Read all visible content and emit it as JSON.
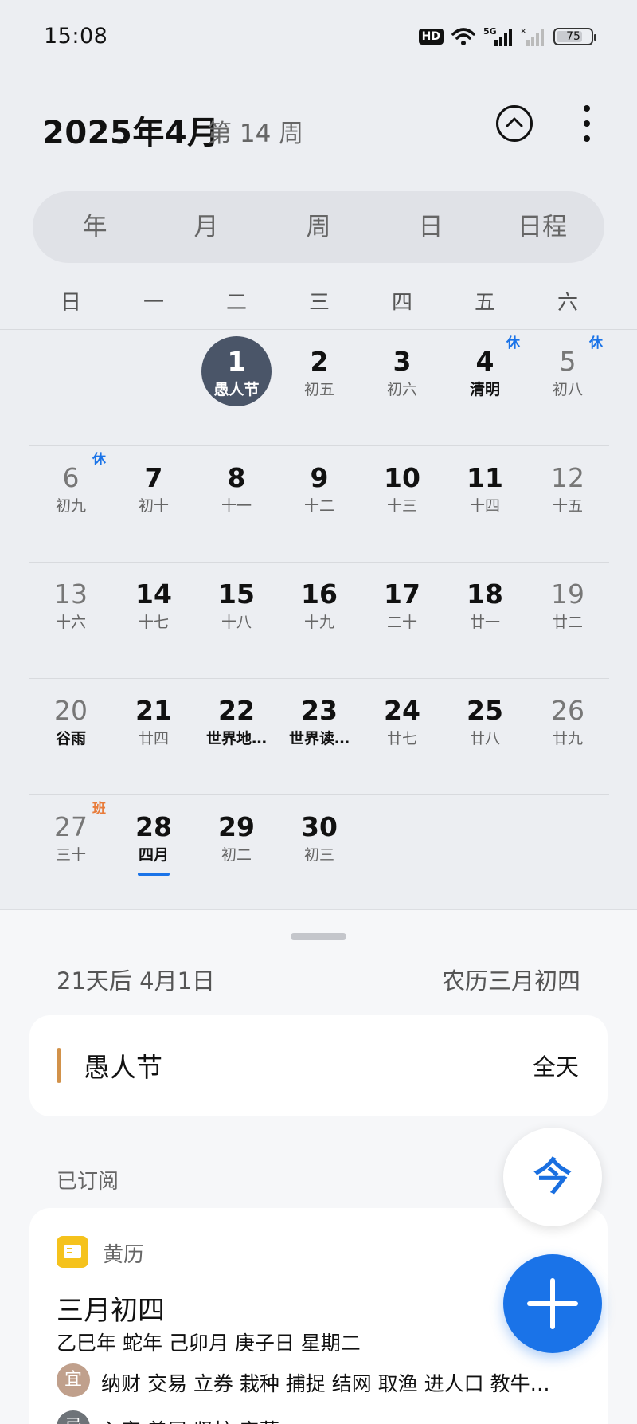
{
  "status_bar": {
    "time": "15:08",
    "hd": "HD",
    "network": "5G",
    "battery_level": 75,
    "battery_text": "75"
  },
  "header": {
    "title": "2025年4月",
    "week": "第 14 周"
  },
  "view_tabs": [
    {
      "label": "年",
      "active": false
    },
    {
      "label": "月",
      "active": true
    },
    {
      "label": "周",
      "active": false
    },
    {
      "label": "日",
      "active": false
    },
    {
      "label": "日程",
      "active": false
    }
  ],
  "weekdays": [
    "日",
    "一",
    "二",
    "三",
    "四",
    "五",
    "六"
  ],
  "weeks": [
    [
      null,
      null,
      {
        "day": "1",
        "lunar": "愚人节",
        "festival": true,
        "selected": true
      },
      {
        "day": "2",
        "lunar": "初五"
      },
      {
        "day": "3",
        "lunar": "初六"
      },
      {
        "day": "4",
        "lunar": "清明",
        "festival": true,
        "tag": "休",
        "tag_type": "rest"
      },
      {
        "day": "5",
        "lunar": "初八",
        "tag": "休",
        "tag_type": "rest"
      }
    ],
    [
      {
        "day": "6",
        "lunar": "初九",
        "tag": "休",
        "tag_type": "rest"
      },
      {
        "day": "7",
        "lunar": "初十"
      },
      {
        "day": "8",
        "lunar": "十一"
      },
      {
        "day": "9",
        "lunar": "十二"
      },
      {
        "day": "10",
        "lunar": "十三"
      },
      {
        "day": "11",
        "lunar": "十四"
      },
      {
        "day": "12",
        "lunar": "十五"
      }
    ],
    [
      {
        "day": "13",
        "lunar": "十六"
      },
      {
        "day": "14",
        "lunar": "十七"
      },
      {
        "day": "15",
        "lunar": "十八"
      },
      {
        "day": "16",
        "lunar": "十九"
      },
      {
        "day": "17",
        "lunar": "二十"
      },
      {
        "day": "18",
        "lunar": "廿一"
      },
      {
        "day": "19",
        "lunar": "廿二"
      }
    ],
    [
      {
        "day": "20",
        "lunar": "谷雨",
        "festival": true
      },
      {
        "day": "21",
        "lunar": "廿四"
      },
      {
        "day": "22",
        "lunar": "世界地…",
        "festival": true
      },
      {
        "day": "23",
        "lunar": "世界读…",
        "festival": true
      },
      {
        "day": "24",
        "lunar": "廿七"
      },
      {
        "day": "25",
        "lunar": "廿八"
      },
      {
        "day": "26",
        "lunar": "廿九"
      }
    ],
    [
      {
        "day": "27",
        "lunar": "三十",
        "tag": "班",
        "tag_type": "work"
      },
      {
        "day": "28",
        "lunar": "四月",
        "festival": true,
        "today": true
      },
      {
        "day": "29",
        "lunar": "初二"
      },
      {
        "day": "30",
        "lunar": "初三"
      },
      null,
      null,
      null
    ]
  ],
  "selected_info": {
    "relative_date": "21天后  4月1日",
    "lunar_date": "农历三月初四"
  },
  "event": {
    "title": "愚人节",
    "time": "全天",
    "color": "#d2924a"
  },
  "subscribed_label": "已订阅",
  "almanac": {
    "name": "黄历",
    "lunar": "三月初四",
    "ganzhi": "乙巳年 蛇年 己卯月 庚子日 星期二",
    "yi_label": "宜",
    "yi": "纳财 交易 立券 栽种 捕捉 结网 取渔 进人口 教牛…",
    "ji_label": "忌",
    "ji": "入宅 盖屋 竖柱 安葬"
  },
  "fab": {
    "today_label": "今"
  },
  "colors": {
    "accent": "#1a73e8",
    "selected_day": "#4a5568",
    "rest_tag": "#1a73e8",
    "work_tag": "#e87b3a"
  }
}
